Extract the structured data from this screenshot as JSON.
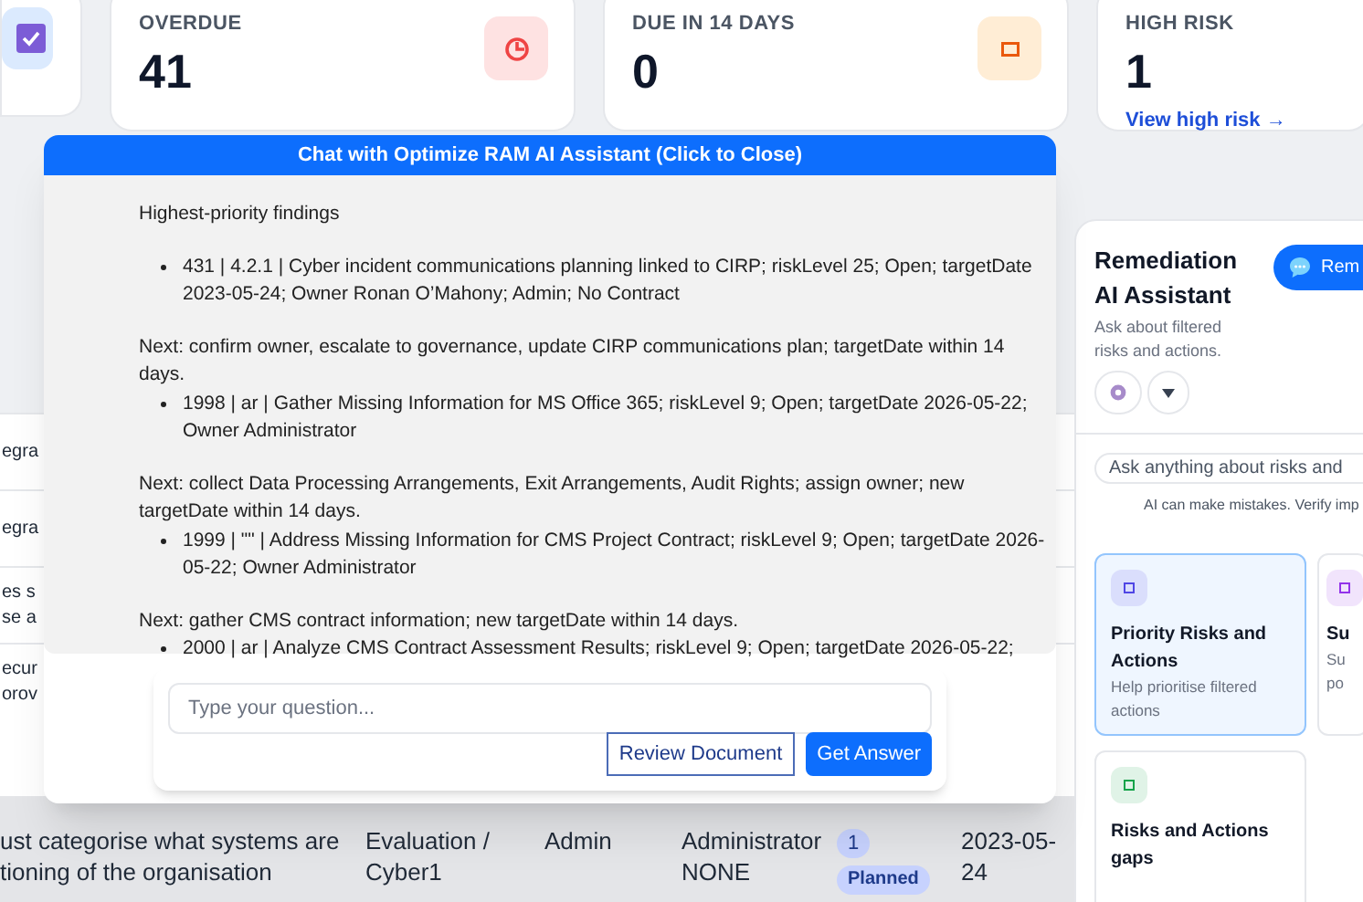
{
  "stats": [
    {
      "kind": "partial"
    },
    {
      "label": "OVERDUE",
      "value": "41",
      "kind": "full"
    },
    {
      "label": "DUE IN 14 DAYS",
      "value": "0",
      "kind": "full"
    },
    {
      "label": "HIGH RISK",
      "value": "1",
      "link": "View high risk →"
    }
  ],
  "table_fragments": [
    [
      "egra"
    ],
    [
      "egra"
    ],
    [
      "es s",
      "se a"
    ],
    [
      "ecur",
      "orov"
    ]
  ],
  "table_row": {
    "cells": [
      [
        "ust categorise what systems are",
        "tioning of the organisation"
      ],
      [
        "Evaluation /",
        "Cyber1"
      ],
      [
        "Admin"
      ],
      [
        "Administrator",
        "NONE"
      ]
    ],
    "badge": "1",
    "status": "Planned",
    "date": [
      "2023-05-",
      "24"
    ]
  },
  "chat": {
    "title": "Chat with Optimize RAM AI Assistant (Click to Close)",
    "blocks": [
      {
        "kind": "heading",
        "text": "Highest-priority findings"
      },
      {
        "kind": "bullet",
        "text": "431 | 4.2.1 | Cyber incident communications planning linked to CIRP; riskLevel 25; Open; targetDate 2023-05-24; Owner Ronan O’Mahony; Admin; No Contract"
      },
      {
        "kind": "para",
        "text": "Next: confirm owner, escalate to governance, update CIRP communications plan; targetDate within 14 days."
      },
      {
        "kind": "bullet",
        "text": "1998 | ar | Gather Missing Information for MS Office 365; riskLevel 9; Open; targetDate 2026-05-22; Owner Administrator"
      },
      {
        "kind": "para",
        "text": "Next: collect Data Processing Arrangements, Exit Arrangements, Audit Rights; assign owner; new targetDate within 14 days."
      },
      {
        "kind": "bullet",
        "text": "1999 | \"\" | Address Missing Information for CMS Project Contract; riskLevel 9; Open; targetDate 2026-05-22; Owner Administrator"
      },
      {
        "kind": "para",
        "text": "Next: gather CMS contract information; new targetDate within 14 days."
      },
      {
        "kind": "bullet",
        "text": "2000 | ar | Analyze CMS Contract Assessment Results; riskLevel 9; Open; targetDate 2026-05-22;"
      }
    ],
    "input": {
      "placeholder": "Type your question..."
    },
    "buttons": [
      {
        "label": "Review Document",
        "kind": "outline"
      },
      {
        "label": "Get Answer",
        "kind": "primary"
      }
    ]
  },
  "assistant": {
    "title": "Remediation AI Assistant",
    "button": "Rem",
    "subtitle": "Ask about filtered risks and actions.",
    "input": {
      "placeholder": "Ask anything about risks and"
    },
    "disclaimer": "AI can make mistakes. Verify imp",
    "cards": [
      {
        "title": "Priority Risks and Actions",
        "text": "Help prioritise filtered actions",
        "selected": true,
        "color": "#4f46e5"
      },
      {
        "title": "Su",
        "text": "Su po",
        "selected": false,
        "color": "#9333ea",
        "kind": "narrow"
      },
      {
        "title": "Risks and Actions gaps",
        "selected": false,
        "color": "#16a34a"
      }
    ]
  }
}
